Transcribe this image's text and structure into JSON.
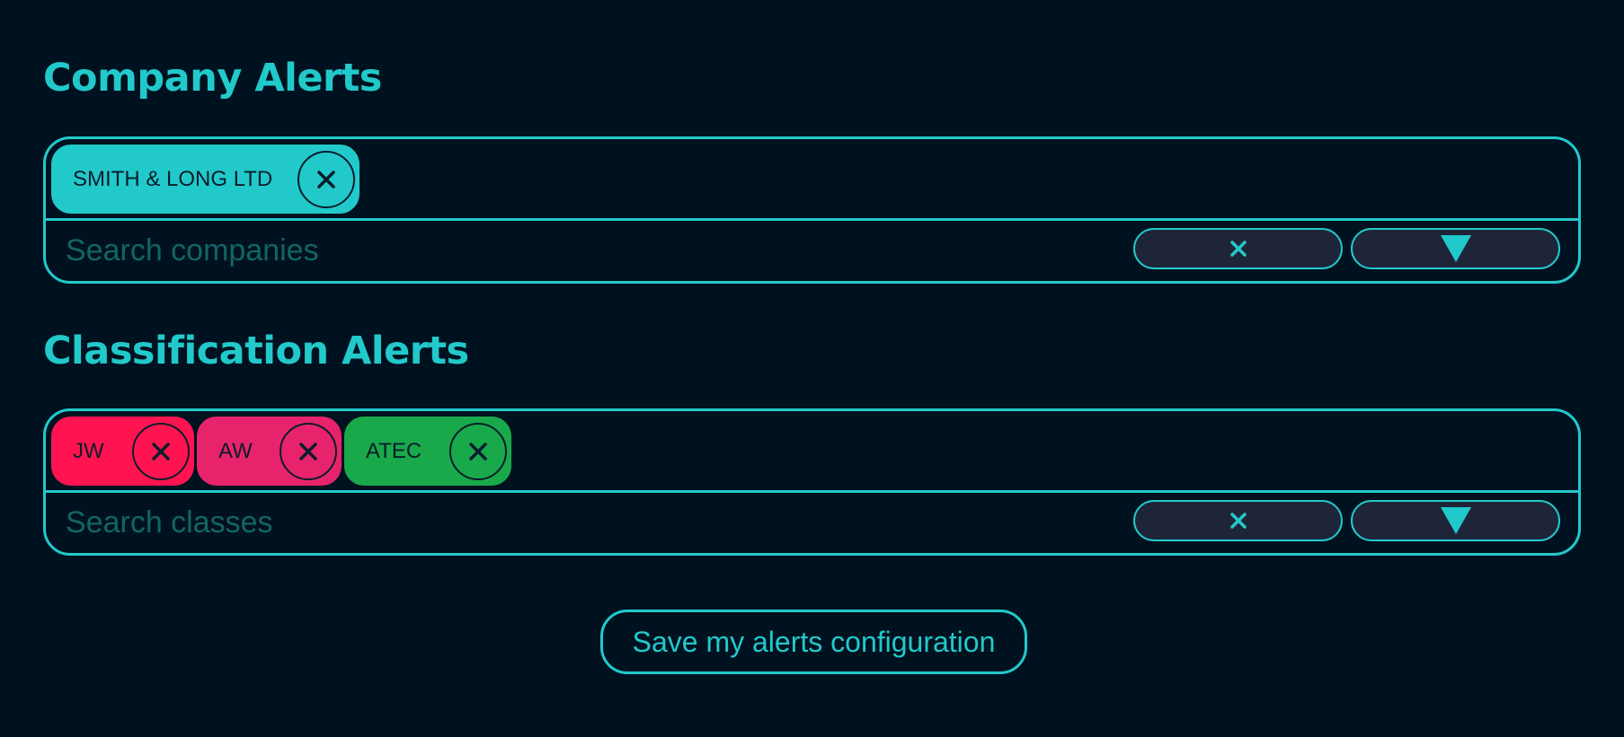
{
  "colors": {
    "background": "#001220",
    "accent": "#22c9cb",
    "placeholder": "#136467",
    "control_fill": "#1f2538",
    "tag_text": "#0a1d2a"
  },
  "company_alerts": {
    "title": "Company Alerts",
    "tags": [
      {
        "label": "SMITH & LONG LTD",
        "color": "#22c9cb",
        "remove_icon": "close-circle-icon"
      }
    ],
    "search_placeholder": "Search companies",
    "clear_icon": "clear-x-icon",
    "toggle_icon": "dropdown-triangle-icon"
  },
  "classification_alerts": {
    "title": "Classification Alerts",
    "tags": [
      {
        "label": "JW",
        "color": "#ff1451",
        "remove_icon": "close-circle-icon"
      },
      {
        "label": "AW",
        "color": "#e7246b",
        "remove_icon": "close-circle-icon"
      },
      {
        "label": "ATEC",
        "color": "#19a94b",
        "remove_icon": "close-circle-icon"
      }
    ],
    "search_placeholder": "Search classes",
    "clear_icon": "clear-x-icon",
    "toggle_icon": "dropdown-triangle-icon"
  },
  "save_button_label": "Save my alerts configuration"
}
